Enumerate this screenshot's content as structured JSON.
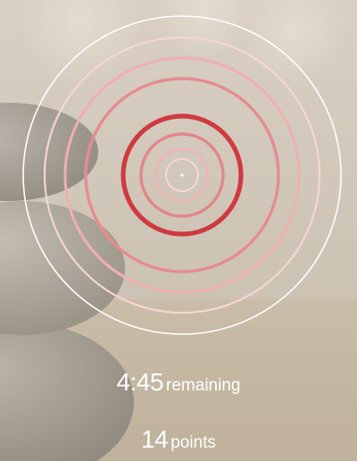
{
  "timer": {
    "value": "4:45",
    "suffix": "remaining"
  },
  "score": {
    "value": "14",
    "suffix": "points"
  },
  "target": {
    "rings_from_outside": [
      "#ffffff",
      "#f6d5d5",
      "#efb0b2",
      "#e58c90",
      "#cf3a40",
      "#e3868b",
      "#f0b4b6",
      "#f7d6d6"
    ]
  },
  "colors": {
    "text": "#ffffff",
    "accent": "#c81e28",
    "background": "#d8d0c4"
  }
}
